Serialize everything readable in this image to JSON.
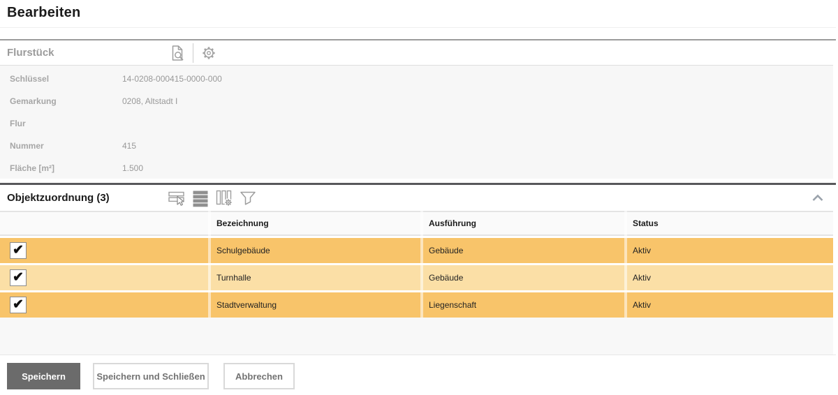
{
  "header": {
    "title": "Bearbeiten"
  },
  "flurstueck": {
    "title": "Flurstück",
    "toolbar": {
      "preview_icon": "document-search",
      "settings_icon": "gear"
    },
    "fields": [
      {
        "label": "Schlüssel",
        "value": "14-0208-000415-0000-000"
      },
      {
        "label": "Gemarkung",
        "value": "0208, Altstadt I"
      },
      {
        "label": "Flur",
        "value": ""
      },
      {
        "label": "Nummer",
        "value": "415"
      },
      {
        "label": "Fläche [m²]",
        "value": "1.500"
      }
    ]
  },
  "objektzuordnung": {
    "title": "Objektzuordnung (3)",
    "count": 3,
    "toolbar_icons": [
      "row-select",
      "rows",
      "column-settings",
      "filter"
    ],
    "collapsed": false,
    "columns": [
      "Bezeichnung",
      "Ausführung",
      "Status"
    ],
    "rows": [
      {
        "checked": true,
        "bezeichnung": "Schulgebäude",
        "ausfuehrung": "Gebäude",
        "status": "Aktiv"
      },
      {
        "checked": true,
        "bezeichnung": "Turnhalle",
        "ausfuehrung": "Gebäude",
        "status": "Aktiv"
      },
      {
        "checked": true,
        "bezeichnung": "Stadtverwaltung",
        "ausfuehrung": "Liegenschaft",
        "status": "Aktiv"
      }
    ]
  },
  "buttons": {
    "save": "Speichern",
    "save_and_close": "Speichern und Schließen",
    "cancel": "Abbrechen"
  },
  "icons": {
    "check": "✔"
  },
  "colors": {
    "row_highlight": "#f8c46a",
    "row_highlight_alt": "#fbdfa6",
    "primary_button_bg": "#6b6b6b",
    "section_line_dark": "#58585b",
    "section_line_gray": "#9c9c9c",
    "form_background": "#f7f7f7"
  }
}
